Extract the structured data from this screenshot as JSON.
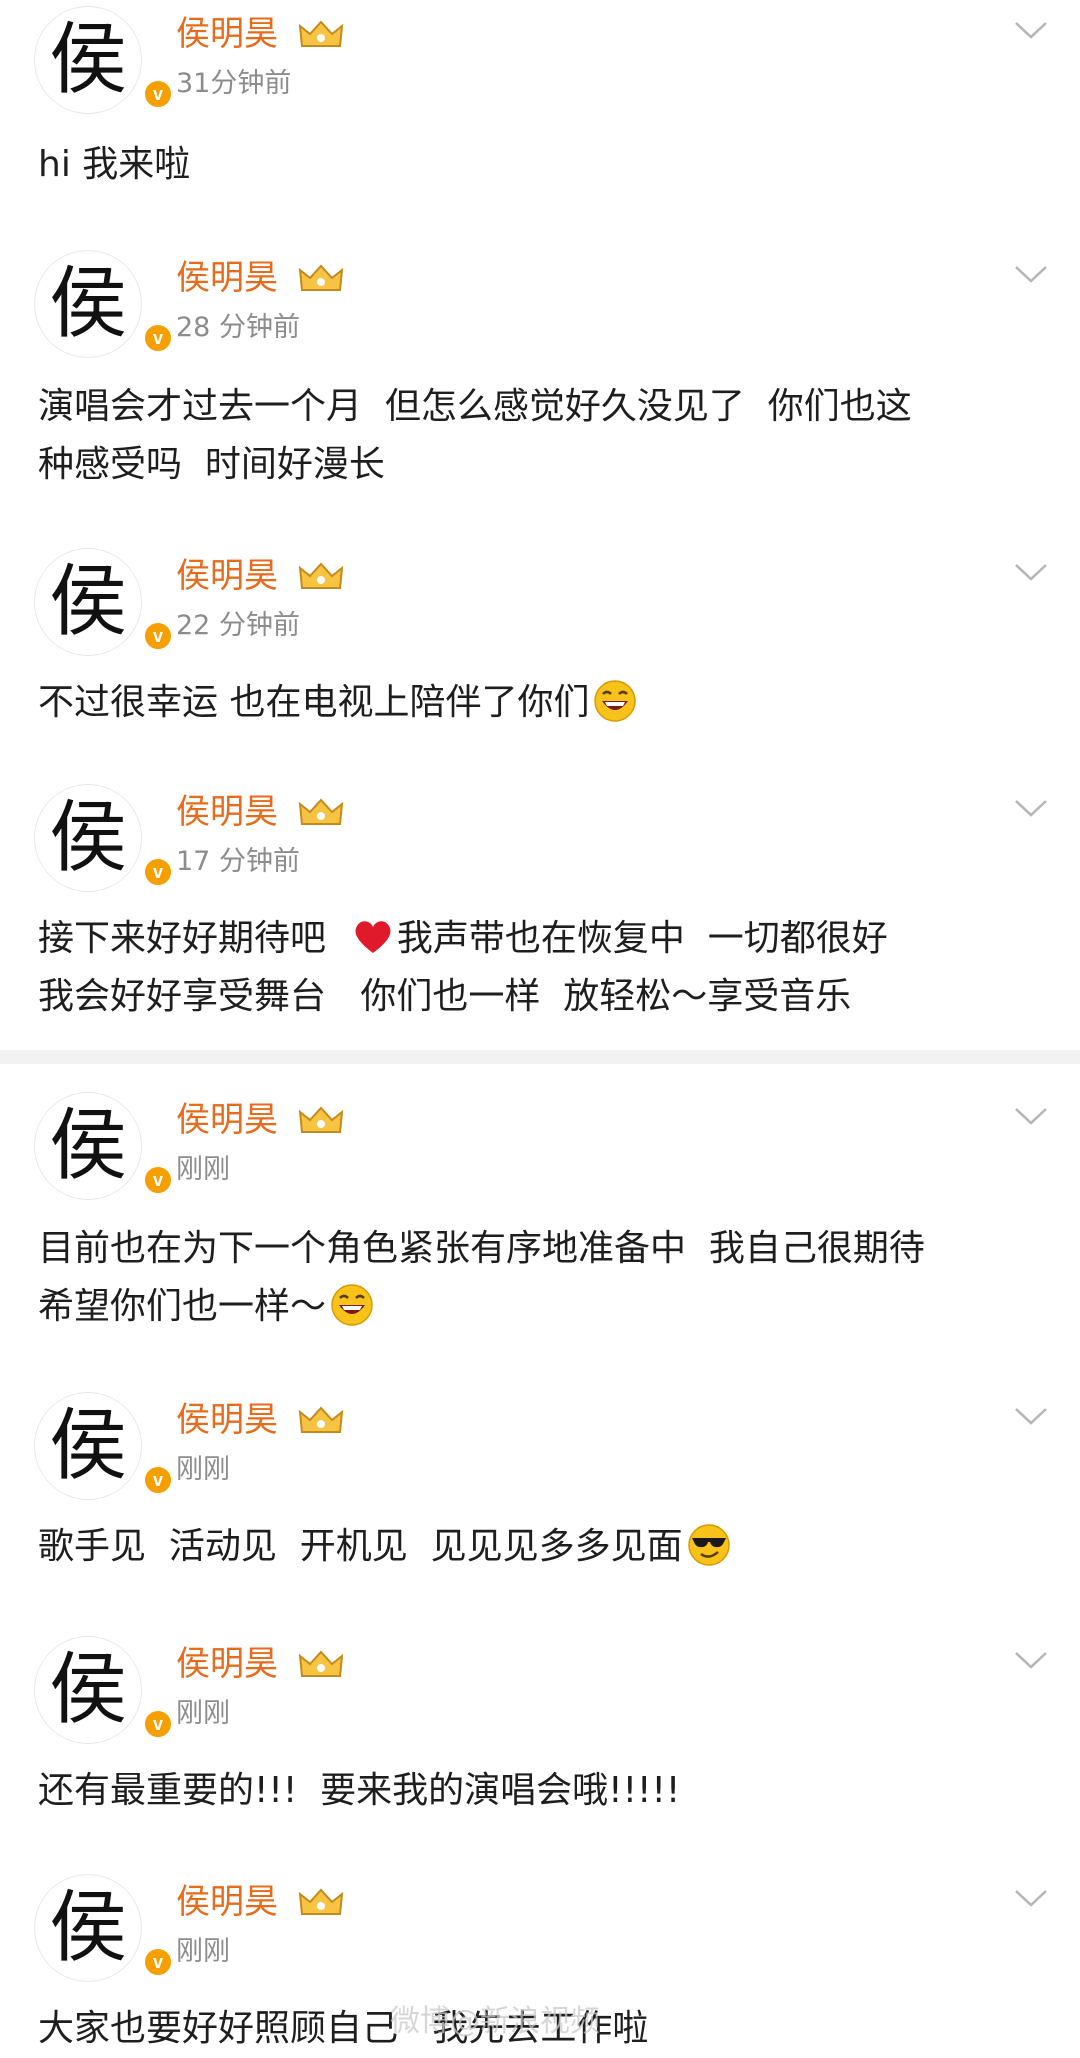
{
  "user": {
    "name": "侯明昊",
    "avatar_char": "侯",
    "verified_mark": "v"
  },
  "posts": [
    {
      "time": "31分钟前",
      "content": "hi 我来啦"
    },
    {
      "time": "28 分钟前",
      "line1": "演唱会才过去一个月  但怎么感觉好久没见了  你们也这",
      "line2": "种感受吗  时间好漫长"
    },
    {
      "time": "22 分钟前",
      "content": "不过很幸运 也在电视上陪伴了你们",
      "emoji": "grinning-sweat-emoji-icon"
    },
    {
      "time": "17 分钟前",
      "line1a": "接下来好好期待吧  ",
      "line1b": "我声带也在恢复中  一切都很好",
      "line2": "我会好好享受舞台   你们也一样  放轻松～享受音乐",
      "emoji": "red-heart-icon"
    },
    {
      "time": "刚刚",
      "line1": "目前也在为下一个角色紧张有序地准备中  我自己很期待",
      "line2": "希望你们也一样～",
      "emoji": "grinning-sweat-emoji-icon"
    },
    {
      "time": "刚刚",
      "content": "歌手见  活动见  开机见  见见见多多见面",
      "emoji": "sunglasses-emoji-icon"
    },
    {
      "time": "刚刚",
      "content": "还有最重要的!!!  要来我的演唱会哦!!!!!"
    },
    {
      "time": "刚刚",
      "content": "大家也要好好照顾自己   我先去工作啦"
    }
  ],
  "watermark": "微博@新浪视频",
  "colors": {
    "username": "#e86b1c",
    "time": "#8c8c8c",
    "badge": "#f5a000",
    "divider": "#f2f2f2"
  }
}
